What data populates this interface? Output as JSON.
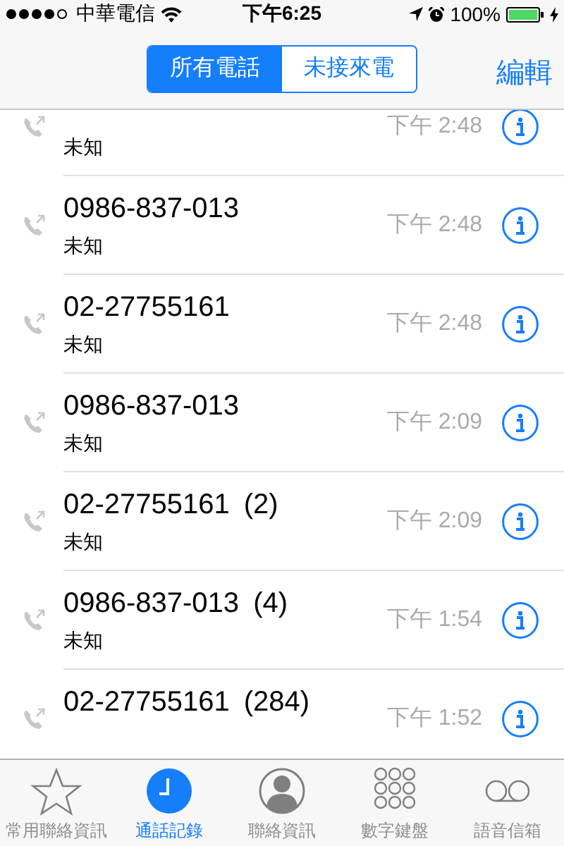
{
  "status_bar": {
    "carrier": "中華電信",
    "time": "下午6:25",
    "battery": "100%"
  },
  "nav": {
    "segments": [
      {
        "label": "所有電話",
        "selected": true
      },
      {
        "label": "未接來電",
        "selected": false
      }
    ],
    "edit": "編輯"
  },
  "calls": [
    {
      "label": "未知",
      "time": "下午 2:48"
    },
    {
      "number": "0986-837-013",
      "label": "未知",
      "time": "下午 2:48"
    },
    {
      "number": "02-27755161",
      "label": "未知",
      "time": "下午 2:48"
    },
    {
      "number": "0986-837-013",
      "label": "未知",
      "time": "下午 2:09"
    },
    {
      "number": "02-27755161",
      "count": "(2)",
      "label": "未知",
      "time": "下午 2:09"
    },
    {
      "number": "0986-837-013",
      "count": "(4)",
      "label": "未知",
      "time": "下午 1:54"
    },
    {
      "number": "02-27755161",
      "count": "(284)",
      "time": "下午 1:52"
    }
  ],
  "tabs": [
    {
      "label": "常用聯絡資訊",
      "selected": false
    },
    {
      "label": "通話記錄",
      "selected": true
    },
    {
      "label": "聯絡資訊",
      "selected": false
    },
    {
      "label": "數字鍵盤",
      "selected": false
    },
    {
      "label": "語音信箱",
      "selected": false
    }
  ]
}
